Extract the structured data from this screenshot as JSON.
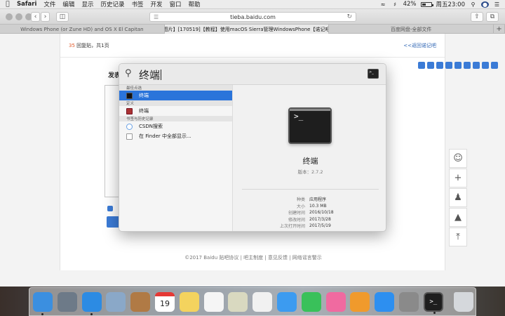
{
  "menubar": {
    "apple_icon": "apple-icon",
    "app_name": "Safari",
    "items": [
      "文件",
      "编辑",
      "显示",
      "历史记录",
      "书签",
      "开发",
      "窗口",
      "帮助"
    ],
    "battery_percent": "42%",
    "battery_level": 0.42,
    "clock": "周五23:00"
  },
  "toolbar": {
    "url": "tieba.baidu.com",
    "back_icon": "chevron-left-icon",
    "forward_icon": "chevron-right-icon"
  },
  "tabs": [
    {
      "label": "Windows Phone (or Zune HD) and OS X El Capitan",
      "active": false
    },
    {
      "label": "【图片】[170519]【教程】使用macOS Sierra管理WindowsPhone【诺记吧…",
      "active": true
    },
    {
      "label": "百度网盘-全部文件",
      "active": false
    }
  ],
  "page": {
    "replies_count": "35",
    "replies_text": " 回复贴，共1页",
    "back_link": "<<返回诺记吧",
    "post_label": "发表",
    "footer": "©2017 Baidu 贴吧协议 | 吧主制度 | 意见反馈 | 网络谣言警示"
  },
  "spotlight": {
    "query": "终端",
    "categories": [
      {
        "title": "最佳点选",
        "items": [
          {
            "label": "终端",
            "icon": "terminal-icon",
            "selected": true
          }
        ]
      },
      {
        "title": "定义",
        "items": [
          {
            "label": "终端",
            "icon": "dictionary-icon",
            "selected": false
          }
        ]
      },
      {
        "title": "书签与历史记录",
        "items": [
          {
            "label": "CSDN搜索",
            "icon": "safari-bookmark-icon",
            "selected": false
          },
          {
            "label": "在 Finder 中全部显示...",
            "icon": "finder-icon",
            "selected": false
          }
        ]
      }
    ],
    "preview": {
      "title": "终端",
      "version": "版本：2.7.2",
      "prompt": ">_",
      "meta": [
        {
          "k": "种类",
          "v": "应用程序"
        },
        {
          "k": "大小",
          "v": "10.3 MB"
        },
        {
          "k": "创建时间",
          "v": "2016/10/18"
        },
        {
          "k": "修改时间",
          "v": "2017/3/28"
        },
        {
          "k": "上次打开时间",
          "v": "2017/5/19"
        }
      ]
    }
  },
  "dock": {
    "apps": [
      {
        "name": "finder",
        "color": "#3b8fe0",
        "running": true
      },
      {
        "name": "launchpad",
        "color": "#6d7a88",
        "running": false
      },
      {
        "name": "safari",
        "color": "#2c8be3",
        "running": true
      },
      {
        "name": "mail",
        "color": "#8aa8c8",
        "running": false
      },
      {
        "name": "contacts",
        "color": "#b07a45",
        "running": false
      },
      {
        "name": "calendar",
        "color": "#ffffff",
        "running": false,
        "label": "19"
      },
      {
        "name": "notes",
        "color": "#f4d35e",
        "running": false
      },
      {
        "name": "reminders",
        "color": "#f5f5f5",
        "running": false
      },
      {
        "name": "preview",
        "color": "#d9d9c0",
        "running": false
      },
      {
        "name": "photos",
        "color": "#f1f1f1",
        "running": false
      },
      {
        "name": "messages",
        "color": "#3c9bf0",
        "running": false
      },
      {
        "name": "facetime",
        "color": "#39c15a",
        "running": false
      },
      {
        "name": "itunes",
        "color": "#f06aa0",
        "running": false
      },
      {
        "name": "ibooks",
        "color": "#f09a2c",
        "running": false
      },
      {
        "name": "app-store",
        "color": "#2d8ff0",
        "running": false
      },
      {
        "name": "system-preferences",
        "color": "#8a8a8a",
        "running": false
      },
      {
        "name": "terminal",
        "color": "#1e1e1e",
        "running": true,
        "label": ">_"
      }
    ],
    "trash": {
      "name": "trash",
      "color": "#d5d8dc"
    }
  }
}
